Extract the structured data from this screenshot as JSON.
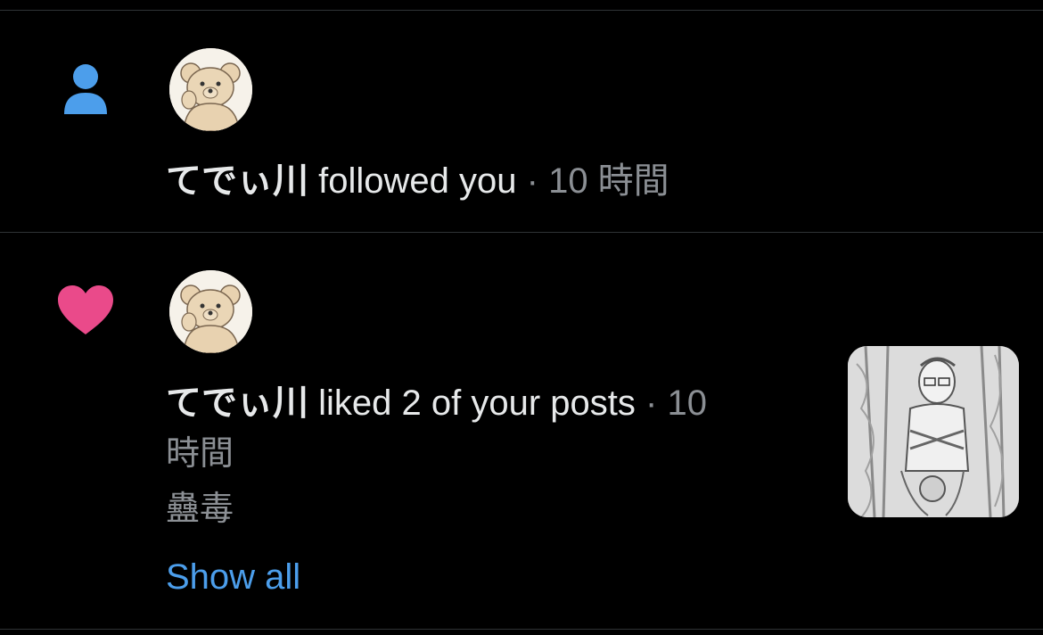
{
  "notifications": [
    {
      "type_icon": "person-icon",
      "icon_color": "#4c9eeb",
      "username": "てでぃ川",
      "action": "followed you",
      "separator": "·",
      "time": "10 時間"
    },
    {
      "type_icon": "heart-icon",
      "icon_color": "#ea4a8a",
      "username": "てでぃ川",
      "action": "liked 2 of your posts",
      "separator": "·",
      "time_part1": "10",
      "time_part2": "時間",
      "post_text": "蠱毒",
      "show_all": "Show all"
    }
  ],
  "colors": {
    "background": "#000000",
    "divider": "#2f3336",
    "text": "#e7e9ea",
    "secondary": "#8b8f94",
    "link": "#4c9eeb"
  }
}
